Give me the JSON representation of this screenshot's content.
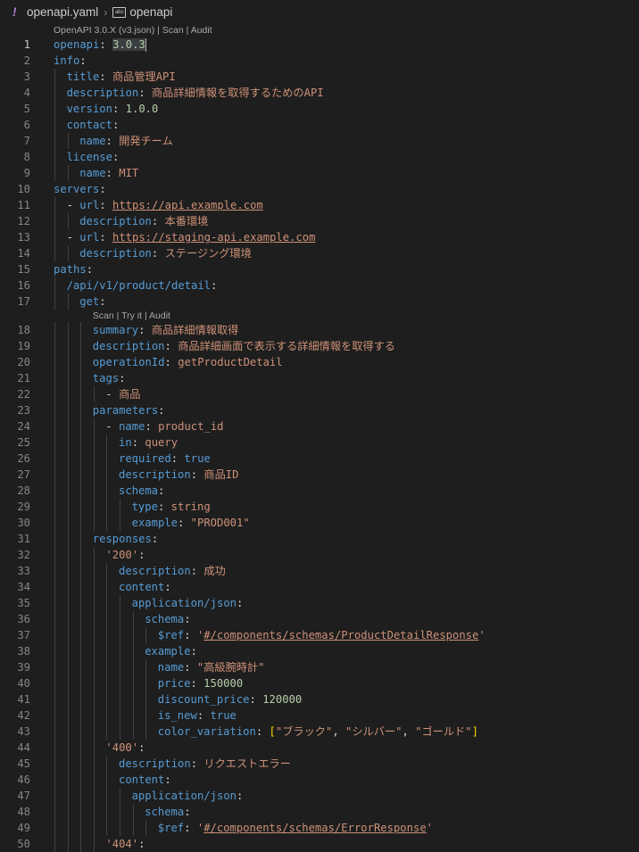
{
  "breadcrumb": {
    "file": "openapi.yaml",
    "symbol": "openapi",
    "separator": "›",
    "file_icon": "yaml-exclamation-icon",
    "symbol_icon": "key-symbol-icon"
  },
  "lenses": {
    "top": "OpenAPI 3.0.X (v3.json) | Scan | Audit",
    "get": "Scan | Try it | Audit"
  },
  "colors": {
    "background": "#1e1e1e",
    "key": "#569cd6",
    "string": "#ce9178",
    "number": "#b5cea8",
    "bracket": "#ffd700",
    "line_number": "#858585"
  },
  "lines": [
    {
      "n": 1,
      "i": 0,
      "t": [
        [
          "k",
          "openapi"
        ],
        [
          "p",
          ": "
        ],
        [
          "n",
          "3.0.3",
          "sel"
        ]
      ],
      "active": true,
      "caret": true
    },
    {
      "n": 2,
      "i": 0,
      "t": [
        [
          "k",
          "info"
        ],
        [
          "p",
          ":"
        ]
      ]
    },
    {
      "n": 3,
      "i": 1,
      "t": [
        [
          "k",
          "title"
        ],
        [
          "p",
          ": "
        ],
        [
          "s",
          "商品管理API"
        ]
      ]
    },
    {
      "n": 4,
      "i": 1,
      "t": [
        [
          "k",
          "description"
        ],
        [
          "p",
          ": "
        ],
        [
          "s",
          "商品詳細情報を取得するためのAPI"
        ]
      ]
    },
    {
      "n": 5,
      "i": 1,
      "t": [
        [
          "k",
          "version"
        ],
        [
          "p",
          ": "
        ],
        [
          "n",
          "1.0.0"
        ]
      ]
    },
    {
      "n": 6,
      "i": 1,
      "t": [
        [
          "k",
          "contact"
        ],
        [
          "p",
          ":"
        ]
      ]
    },
    {
      "n": 7,
      "i": 2,
      "t": [
        [
          "k",
          "name"
        ],
        [
          "p",
          ": "
        ],
        [
          "s",
          "開発チーム"
        ]
      ]
    },
    {
      "n": 8,
      "i": 1,
      "t": [
        [
          "k",
          "license"
        ],
        [
          "p",
          ":"
        ]
      ]
    },
    {
      "n": 9,
      "i": 2,
      "t": [
        [
          "k",
          "name"
        ],
        [
          "p",
          ": "
        ],
        [
          "s",
          "MIT"
        ]
      ]
    },
    {
      "n": 10,
      "i": 0,
      "t": [
        [
          "k",
          "servers"
        ],
        [
          "p",
          ":"
        ]
      ]
    },
    {
      "n": 11,
      "i": 1,
      "t": [
        [
          "p",
          "- "
        ],
        [
          "k",
          "url"
        ],
        [
          "p",
          ": "
        ],
        [
          "s",
          "https://api.example.com",
          "link"
        ]
      ]
    },
    {
      "n": 12,
      "i": 2,
      "t": [
        [
          "k",
          "description"
        ],
        [
          "p",
          ": "
        ],
        [
          "s",
          "本番環境"
        ]
      ]
    },
    {
      "n": 13,
      "i": 1,
      "t": [
        [
          "p",
          "- "
        ],
        [
          "k",
          "url"
        ],
        [
          "p",
          ": "
        ],
        [
          "s",
          "https://staging-api.example.com",
          "link"
        ]
      ]
    },
    {
      "n": 14,
      "i": 2,
      "t": [
        [
          "k",
          "description"
        ],
        [
          "p",
          ": "
        ],
        [
          "s",
          "ステージング環境"
        ]
      ]
    },
    {
      "n": 15,
      "i": 0,
      "t": [
        [
          "k",
          "paths"
        ],
        [
          "p",
          ":"
        ]
      ]
    },
    {
      "n": 16,
      "i": 1,
      "t": [
        [
          "k",
          "/api/v1/product/detail"
        ],
        [
          "p",
          ":"
        ]
      ]
    },
    {
      "n": 17,
      "i": 2,
      "t": [
        [
          "k",
          "get"
        ],
        [
          "p",
          ":"
        ]
      ],
      "lens_after": "get"
    },
    {
      "n": 18,
      "i": 3,
      "t": [
        [
          "k",
          "summary"
        ],
        [
          "p",
          ": "
        ],
        [
          "s",
          "商品詳細情報取得"
        ]
      ]
    },
    {
      "n": 19,
      "i": 3,
      "t": [
        [
          "k",
          "description"
        ],
        [
          "p",
          ": "
        ],
        [
          "s",
          "商品詳細画面で表示する詳細情報を取得する"
        ]
      ]
    },
    {
      "n": 20,
      "i": 3,
      "t": [
        [
          "k",
          "operationId"
        ],
        [
          "p",
          ": "
        ],
        [
          "s",
          "getProductDetail"
        ]
      ]
    },
    {
      "n": 21,
      "i": 3,
      "t": [
        [
          "k",
          "tags"
        ],
        [
          "p",
          ":"
        ]
      ]
    },
    {
      "n": 22,
      "i": 4,
      "t": [
        [
          "p",
          "- "
        ],
        [
          "s",
          "商品"
        ]
      ]
    },
    {
      "n": 23,
      "i": 3,
      "t": [
        [
          "k",
          "parameters"
        ],
        [
          "p",
          ":"
        ]
      ]
    },
    {
      "n": 24,
      "i": 4,
      "t": [
        [
          "p",
          "- "
        ],
        [
          "k",
          "name"
        ],
        [
          "p",
          ": "
        ],
        [
          "s",
          "product_id"
        ]
      ]
    },
    {
      "n": 25,
      "i": 5,
      "t": [
        [
          "k",
          "in"
        ],
        [
          "p",
          ": "
        ],
        [
          "s",
          "query"
        ]
      ]
    },
    {
      "n": 26,
      "i": 5,
      "t": [
        [
          "k",
          "required"
        ],
        [
          "p",
          ": "
        ],
        [
          "b",
          "true"
        ]
      ]
    },
    {
      "n": 27,
      "i": 5,
      "t": [
        [
          "k",
          "description"
        ],
        [
          "p",
          ": "
        ],
        [
          "s",
          "商品ID"
        ]
      ]
    },
    {
      "n": 28,
      "i": 5,
      "t": [
        [
          "k",
          "schema"
        ],
        [
          "p",
          ":"
        ]
      ]
    },
    {
      "n": 29,
      "i": 6,
      "t": [
        [
          "k",
          "type"
        ],
        [
          "p",
          ": "
        ],
        [
          "s",
          "string"
        ]
      ]
    },
    {
      "n": 30,
      "i": 6,
      "t": [
        [
          "k",
          "example"
        ],
        [
          "p",
          ": "
        ],
        [
          "s",
          "\"PROD001\""
        ]
      ]
    },
    {
      "n": 31,
      "i": 3,
      "t": [
        [
          "k",
          "responses"
        ],
        [
          "p",
          ":"
        ]
      ]
    },
    {
      "n": 32,
      "i": 4,
      "t": [
        [
          "s",
          "'200'"
        ],
        [
          "p",
          ":"
        ]
      ]
    },
    {
      "n": 33,
      "i": 5,
      "t": [
        [
          "k",
          "description"
        ],
        [
          "p",
          ": "
        ],
        [
          "s",
          "成功"
        ]
      ]
    },
    {
      "n": 34,
      "i": 5,
      "t": [
        [
          "k",
          "content"
        ],
        [
          "p",
          ":"
        ]
      ]
    },
    {
      "n": 35,
      "i": 6,
      "t": [
        [
          "k",
          "application/json"
        ],
        [
          "p",
          ":"
        ]
      ]
    },
    {
      "n": 36,
      "i": 7,
      "t": [
        [
          "k",
          "schema"
        ],
        [
          "p",
          ":"
        ]
      ]
    },
    {
      "n": 37,
      "i": 8,
      "t": [
        [
          "k",
          "$ref"
        ],
        [
          "p",
          ": "
        ],
        [
          "s",
          "'"
        ],
        [
          "s",
          "#/components/schemas/ProductDetailResponse",
          "link"
        ],
        [
          "s",
          "'"
        ]
      ]
    },
    {
      "n": 38,
      "i": 7,
      "t": [
        [
          "k",
          "example"
        ],
        [
          "p",
          ":"
        ]
      ]
    },
    {
      "n": 39,
      "i": 8,
      "t": [
        [
          "k",
          "name"
        ],
        [
          "p",
          ": "
        ],
        [
          "s",
          "\"高級腕時計\""
        ]
      ]
    },
    {
      "n": 40,
      "i": 8,
      "t": [
        [
          "k",
          "price"
        ],
        [
          "p",
          ": "
        ],
        [
          "n",
          "150000"
        ]
      ]
    },
    {
      "n": 41,
      "i": 8,
      "t": [
        [
          "k",
          "discount_price"
        ],
        [
          "p",
          ": "
        ],
        [
          "n",
          "120000"
        ]
      ]
    },
    {
      "n": 42,
      "i": 8,
      "t": [
        [
          "k",
          "is_new"
        ],
        [
          "p",
          ": "
        ],
        [
          "b",
          "true"
        ]
      ]
    },
    {
      "n": 43,
      "i": 8,
      "t": [
        [
          "k",
          "color_variation"
        ],
        [
          "p",
          ": "
        ],
        [
          "br",
          "["
        ],
        [
          "s",
          "\"ブラック\""
        ],
        [
          "p",
          ", "
        ],
        [
          "s",
          "\"シルバー\""
        ],
        [
          "p",
          ", "
        ],
        [
          "s",
          "\"ゴールド\""
        ],
        [
          "br",
          "]"
        ]
      ]
    },
    {
      "n": 44,
      "i": 4,
      "t": [
        [
          "s",
          "'400'"
        ],
        [
          "p",
          ":"
        ]
      ]
    },
    {
      "n": 45,
      "i": 5,
      "t": [
        [
          "k",
          "description"
        ],
        [
          "p",
          ": "
        ],
        [
          "s",
          "リクエストエラー"
        ]
      ]
    },
    {
      "n": 46,
      "i": 5,
      "t": [
        [
          "k",
          "content"
        ],
        [
          "p",
          ":"
        ]
      ]
    },
    {
      "n": 47,
      "i": 6,
      "t": [
        [
          "k",
          "application/json"
        ],
        [
          "p",
          ":"
        ]
      ]
    },
    {
      "n": 48,
      "i": 7,
      "t": [
        [
          "k",
          "schema"
        ],
        [
          "p",
          ":"
        ]
      ]
    },
    {
      "n": 49,
      "i": 8,
      "t": [
        [
          "k",
          "$ref"
        ],
        [
          "p",
          ": "
        ],
        [
          "s",
          "'"
        ],
        [
          "s",
          "#/components/schemas/ErrorResponse",
          "link"
        ],
        [
          "s",
          "'"
        ]
      ]
    },
    {
      "n": 50,
      "i": 4,
      "t": [
        [
          "s",
          "'404'"
        ],
        [
          "p",
          ":"
        ]
      ]
    }
  ]
}
